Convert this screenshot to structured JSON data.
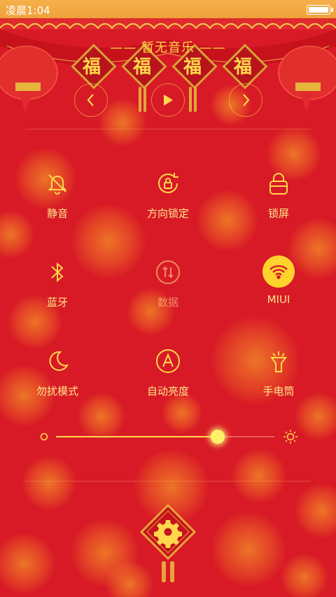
{
  "status_bar": {
    "time": "凌晨1:04",
    "battery_icon": "battery-full-icon"
  },
  "music": {
    "title": "—— 暂无音乐 ——",
    "fu_char": "福",
    "prev_icon": "previous-icon",
    "play_icon": "play-icon",
    "next_icon": "next-icon"
  },
  "toggles": [
    {
      "label": "静音",
      "icon": "bell-off-icon",
      "state": "off"
    },
    {
      "label": "方向锁定",
      "icon": "rotation-lock-icon",
      "state": "off"
    },
    {
      "label": "锁屏",
      "icon": "lock-icon",
      "state": "off"
    },
    {
      "label": "蓝牙",
      "icon": "bluetooth-icon",
      "state": "off"
    },
    {
      "label": "数据",
      "icon": "mobile-data-icon",
      "state": "disabled"
    },
    {
      "label": "MIUI",
      "icon": "wifi-icon",
      "state": "on"
    },
    {
      "label": "勿扰模式",
      "icon": "moon-icon",
      "state": "off"
    },
    {
      "label": "自动亮度",
      "icon": "auto-brightness-icon",
      "state": "off"
    },
    {
      "label": "手电筒",
      "icon": "flashlight-icon",
      "state": "off"
    }
  ],
  "brightness": {
    "value": 0.74,
    "min_icon": "brightness-low-icon",
    "max_icon": "brightness-high-icon"
  },
  "settings_icon": "gear-icon",
  "colors": {
    "background": "#d81a26",
    "accent": "#ffd84a",
    "status_bar": "#f0a23d"
  }
}
